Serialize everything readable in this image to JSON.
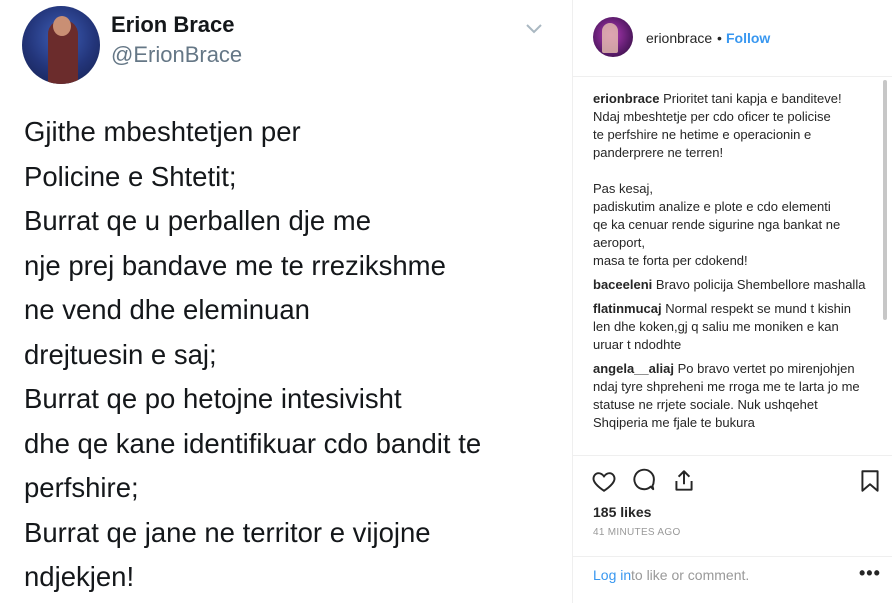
{
  "tweet": {
    "display_name": "Erion Brace",
    "handle": "@ErionBrace",
    "lines": [
      "Gjithe mbeshtetjen per",
      "Policine e Shtetit;",
      "Burrat qe u perballen dje me",
      "nje prej bandave me te rrezikshme",
      "ne vend dhe eleminuan",
      "drejtuesin e saj;",
      "Burrat qe po hetojne intesivisht",
      "dhe qe kane identifikuar cdo bandit te",
      "perfshire;",
      "Burrat qe jane ne territor e vijojne",
      "ndjekjen!"
    ]
  },
  "post": {
    "username": "erionbrace",
    "dot": "•",
    "follow_label": "Follow",
    "caption_user": "erionbrace",
    "caption_lines": [
      "Prioritet tani kapja e banditeve!",
      "Ndaj mbeshtetje per cdo oficer te policise",
      "te perfshire ne hetime e operacionin e",
      "panderprere ne terren!",
      "",
      "Pas kesaj,",
      "padiskutim analize e plote e cdo elementi",
      "qe ka cenuar rende sigurine nga bankat ne",
      "aeroport,",
      "masa te forta per cdokend!"
    ],
    "comments": [
      {
        "user": "baceeleni",
        "text": "Bravo policija Shembellore mashalla"
      },
      {
        "user": "flatinmucaj",
        "text": "Normal respekt se mund t kishin len dhe koken,gj q saliu me moniken e kan uruar t ndodhte"
      },
      {
        "user": "angela__aliaj",
        "text": "Po bravo vertet po mirenjohjen ndaj tyre shpreheni me rroga me te larta jo me statuse ne rrjete sociale. Nuk ushqehet Shqiperia me fjale te bukura"
      }
    ],
    "likes": "185 likes",
    "time": "41 MINUTES AGO",
    "login_link": "Log in",
    "login_rest": "to like or comment.",
    "more": "•••"
  }
}
